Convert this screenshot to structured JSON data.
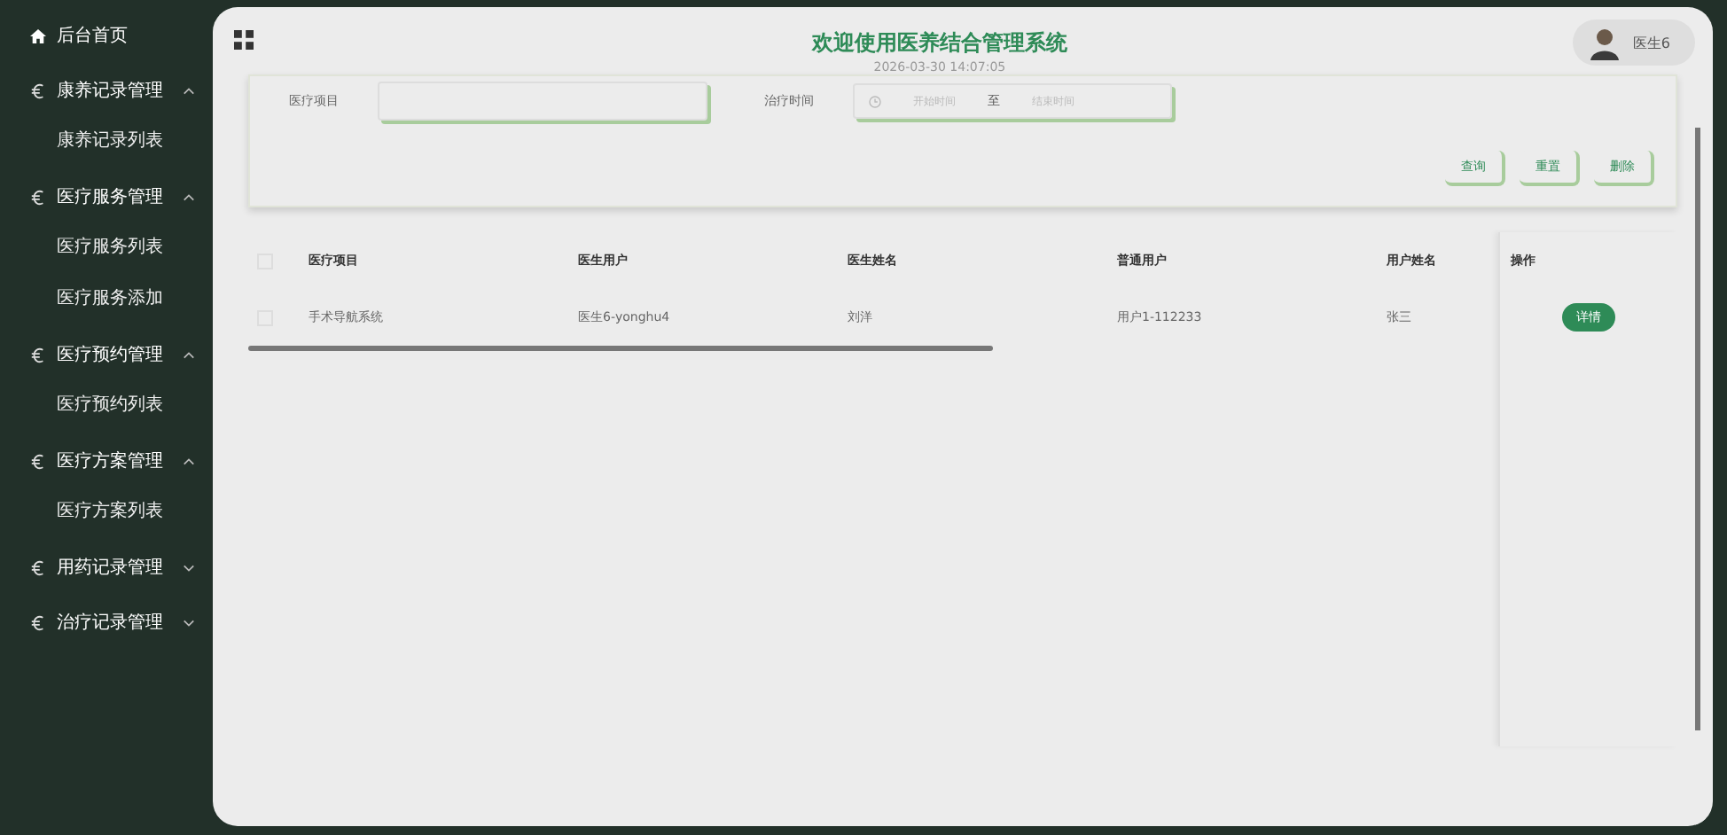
{
  "sidebar": {
    "items": [
      {
        "label": "后台首页",
        "kind": "home"
      },
      {
        "label": "康养记录管理",
        "kind": "group",
        "expanded": true,
        "children": [
          {
            "label": "康养记录列表"
          }
        ]
      },
      {
        "label": "医疗服务管理",
        "kind": "group",
        "expanded": true,
        "children": [
          {
            "label": "医疗服务列表"
          },
          {
            "label": "医疗服务添加"
          }
        ]
      },
      {
        "label": "医疗预约管理",
        "kind": "group",
        "expanded": true,
        "children": [
          {
            "label": "医疗预约列表"
          }
        ]
      },
      {
        "label": "医疗方案管理",
        "kind": "group",
        "expanded": true,
        "children": [
          {
            "label": "医疗方案列表"
          }
        ]
      },
      {
        "label": "用药记录管理",
        "kind": "group",
        "expanded": false
      },
      {
        "label": "治疗记录管理",
        "kind": "group",
        "expanded": false
      }
    ]
  },
  "header": {
    "title": "欢迎使用医养结合管理系统",
    "datetime": "2026-03-30 14:07:05",
    "user": "医生6"
  },
  "search": {
    "item_label": "医疗项目",
    "time_label": "治疗时间",
    "start_placeholder": "开始时间",
    "separator": "至",
    "end_placeholder": "结束时间",
    "buttons": [
      "查询",
      "重置",
      "删除"
    ]
  },
  "table": {
    "all_checked": false,
    "columns": [
      "医疗项目",
      "医生用户",
      "医生姓名",
      "普通用户",
      "用户姓名",
      "操作"
    ],
    "rows": [
      {
        "cells": [
          "手术导航系统",
          "医生6-yonghu4",
          "刘洋",
          "用户1-112233",
          "张三"
        ],
        "action": "详情",
        "checked": false
      }
    ]
  }
}
